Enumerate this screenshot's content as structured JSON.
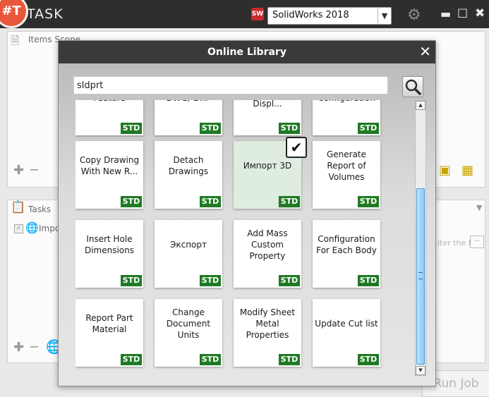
{
  "app": {
    "logo_text": "#T",
    "title": "TASK",
    "cad_selector_value": "SolidWorks 2018",
    "cad_icon_text": "SW"
  },
  "panels": {
    "items_scope_label": "Items Scope",
    "tasks_label": "Tasks",
    "task_item_text": "Impo",
    "filter_placeholder": "iter the f",
    "run_job_label": "Run Job"
  },
  "dialog": {
    "title": "Online Library",
    "search_value": "sldprt",
    "badge_text": "STD",
    "tiles": [
      {
        "label": "Weldment Feature",
        "selected": false
      },
      {
        "label": "Save Part DWG/ DXF",
        "selected": false
      },
      {
        "label": "Configuration For Each Displ...",
        "selected": false
      },
      {
        "label": "Activate Configuration",
        "selected": false
      },
      {
        "label": "Copy Drawing With New R...",
        "selected": false
      },
      {
        "label": "Detach Drawings",
        "selected": false
      },
      {
        "label": "Импорт 3D",
        "selected": true
      },
      {
        "label": "Generate Report of Volumes",
        "selected": false
      },
      {
        "label": "Insert Hole Dimensions",
        "selected": false
      },
      {
        "label": "Экспорт",
        "selected": false
      },
      {
        "label": "Add Mass Custom Property",
        "selected": false
      },
      {
        "label": "Configuration For Each Body",
        "selected": false
      },
      {
        "label": "Report Part Material",
        "selected": false
      },
      {
        "label": "Change Document Units",
        "selected": false
      },
      {
        "label": "Modify Sheet Metal Properties",
        "selected": false
      },
      {
        "label": "Update Cut list",
        "selected": false
      }
    ]
  },
  "colors": {
    "std_badge": "#1f7a23",
    "selected_tile": "#dfece0",
    "title_bar": "#2e2e2e"
  }
}
